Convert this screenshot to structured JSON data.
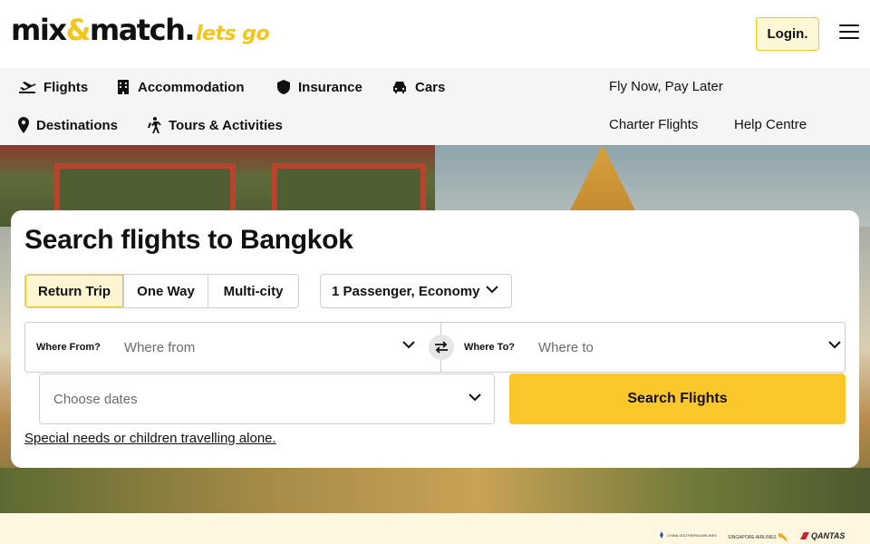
{
  "header": {
    "logo": {
      "main_pre": "mix",
      "amp": "&",
      "main_post": "match.",
      "tagline": "lets go"
    },
    "login_label": "Login."
  },
  "nav": {
    "primary": [
      {
        "label": "Flights",
        "icon": "plane-icon"
      },
      {
        "label": "Accommodation",
        "icon": "building-icon"
      },
      {
        "label": "Insurance",
        "icon": "shield-icon"
      },
      {
        "label": "Cars",
        "icon": "car-icon"
      },
      {
        "label": "Destinations",
        "icon": "map-pin-icon"
      },
      {
        "label": "Tours & Activities",
        "icon": "hiker-icon"
      }
    ],
    "secondary": [
      "Fly Now, Pay Later",
      "Charter Flights",
      "Help Centre"
    ]
  },
  "search": {
    "title": "Search flights to Bangkok",
    "trip_types": [
      "Return Trip",
      "One Way",
      "Multi-city"
    ],
    "active_trip_type": "Return Trip",
    "passengers": "1 Passenger, Economy",
    "from_label": "Where From?",
    "from_placeholder": "Where from",
    "to_label": "Where To?",
    "to_placeholder": "Where to",
    "dates_placeholder": "Choose dates",
    "search_button": "Search Flights",
    "special_link": "Special needs or children travelling alone."
  },
  "partners": [
    "CHINA SOUTHERN AIRLINES",
    "SINGAPORE AIRLINES",
    "QANTAS"
  ],
  "colors": {
    "brand_yellow": "#fcc72a",
    "login_bg": "#fff8d6",
    "nav_bg": "#f5f5f5"
  }
}
